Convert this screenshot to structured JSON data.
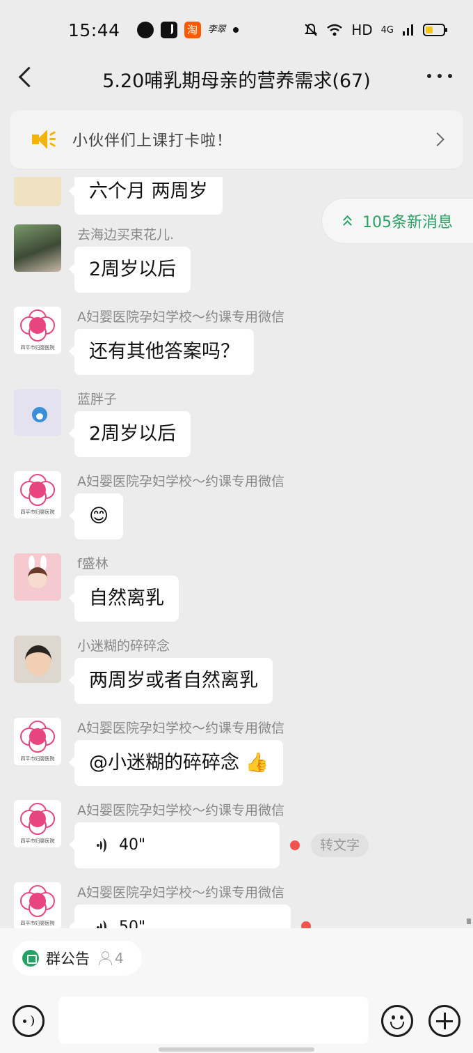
{
  "status_bar": {
    "time": "15:44",
    "taobao_glyph": "淘",
    "signature_glyph": "李翠",
    "network": "HD",
    "cell": "4G",
    "icons": [
      "location-icon",
      "tiktok-icon",
      "taobao-icon",
      "mute-icon",
      "wifi-icon",
      "signal-icon",
      "battery-icon"
    ]
  },
  "header": {
    "title": "5.20哺乳期母亲的营养需求(67)"
  },
  "notice": {
    "text": "小伙伴们上课打卡啦！"
  },
  "new_messages": {
    "label": "105条新消息"
  },
  "hospital_caption": "四平市妇婴医院",
  "messages": [
    {
      "sender": "",
      "text": "六个月  两周岁"
    },
    {
      "sender": "去海边买束花儿.",
      "text": "2周岁以后"
    },
    {
      "sender": "A妇婴医院孕妇学校～约课专用微信",
      "text": "还有其他答案吗？"
    },
    {
      "sender": "蓝胖子",
      "text": "2周岁以后"
    },
    {
      "sender": "A妇婴医院孕妇学校～约课专用微信",
      "text": "😊"
    },
    {
      "sender": "f盛林",
      "text": "自然离乳"
    },
    {
      "sender": "小迷糊的碎碎念",
      "text": "两周岁或者自然离乳"
    },
    {
      "sender": "A妇婴医院孕妇学校～约课专用微信",
      "text": "@小迷糊的碎碎念 👍"
    },
    {
      "sender": "A妇婴医院孕妇学校～约课专用微信",
      "voice_duration": "40\"",
      "transcribe": "转文字"
    },
    {
      "sender": "A妇婴医院孕妇学校～约课专用微信",
      "voice_duration": "50\""
    }
  ],
  "bottom": {
    "announcement": "群公告",
    "member_count": "4",
    "input_value": "",
    "colors": {
      "accent": "#26a264",
      "unread": "#f35350",
      "notice_icon": "#f5b301"
    }
  }
}
